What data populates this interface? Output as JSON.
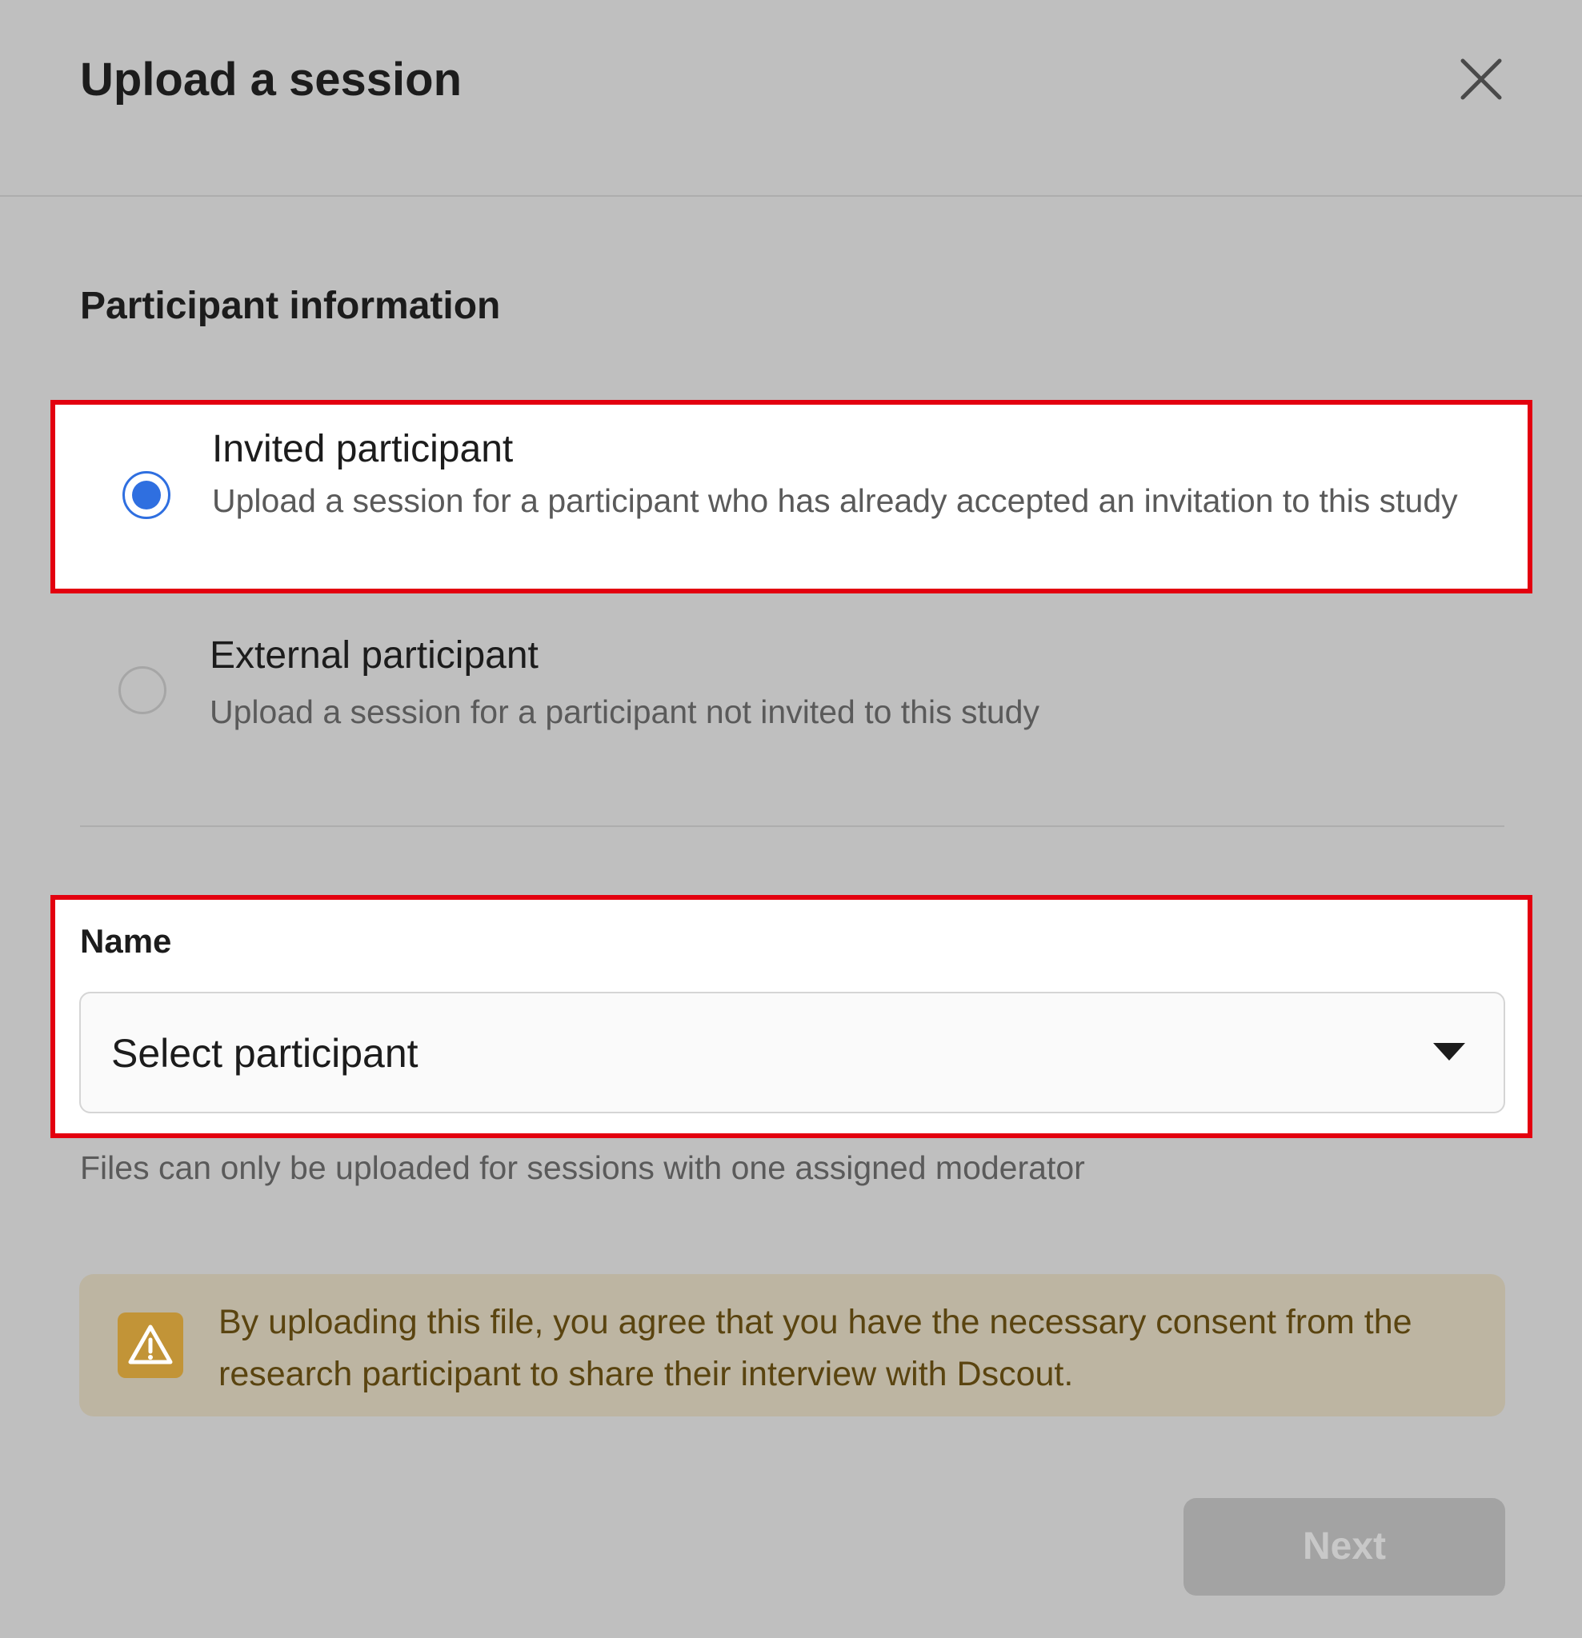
{
  "dialog": {
    "title": "Upload a session",
    "close_icon": "close-icon"
  },
  "section": {
    "title": "Participant information"
  },
  "options": [
    {
      "title": "Invited participant",
      "description": "Upload a session for a participant who has already accepted an invitation to this study",
      "selected": true
    },
    {
      "title": "External participant",
      "description": "Upload a session for a participant not invited to this study",
      "selected": false
    }
  ],
  "name_field": {
    "label": "Name",
    "value": "Select participant",
    "caret_icon": "caret-down-icon"
  },
  "helper_text": "Files can only be uploaded for sessions with one assigned moderator",
  "warning": {
    "icon": "warning-icon",
    "text": "By uploading this file, you agree that you have the necessary consent from the research participant to share their interview with Dscout."
  },
  "footer": {
    "next_label": "Next",
    "next_disabled": true
  },
  "colors": {
    "accent": "#2f6fe0",
    "highlight": "#e3000f",
    "warning_icon": "#c29437",
    "warning_text": "#5a4410"
  }
}
